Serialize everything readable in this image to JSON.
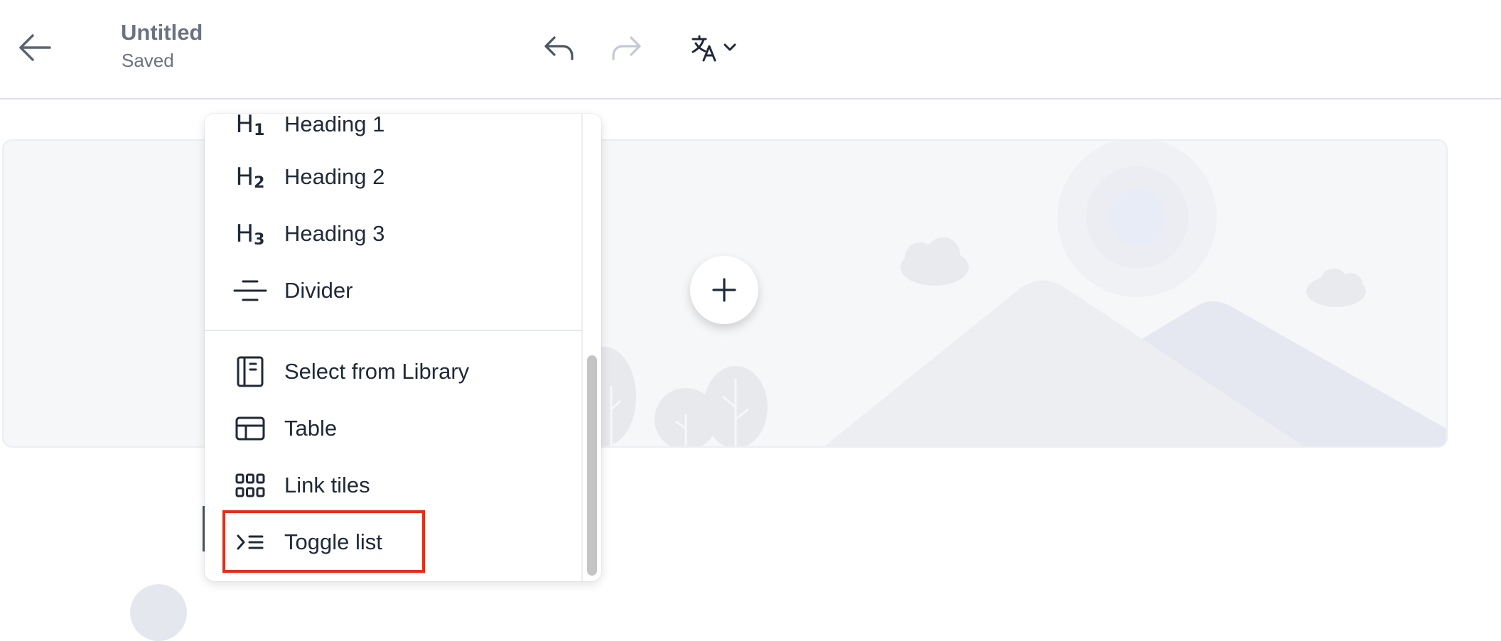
{
  "header": {
    "title": "Untitled",
    "status": "Saved"
  },
  "block_menu": {
    "group1": [
      {
        "label": "Heading 1",
        "icon": "heading-1-icon",
        "icon_text": "H",
        "icon_sub": "1"
      },
      {
        "label": "Heading 2",
        "icon": "heading-2-icon",
        "icon_text": "H",
        "icon_sub": "2"
      },
      {
        "label": "Heading 3",
        "icon": "heading-3-icon",
        "icon_text": "H",
        "icon_sub": "3"
      },
      {
        "label": "Divider",
        "icon": "divider-icon"
      }
    ],
    "group2": [
      {
        "label": "Select from Library",
        "icon": "library-icon"
      },
      {
        "label": "Table",
        "icon": "table-icon"
      },
      {
        "label": "Link tiles",
        "icon": "link-tiles-icon"
      },
      {
        "label": "Toggle list",
        "icon": "toggle-list-icon"
      }
    ]
  },
  "colors": {
    "highlight": "#e3301a",
    "text": "#1f2937",
    "muted": "#6b7280",
    "redo_disabled": "#c3cad4"
  }
}
